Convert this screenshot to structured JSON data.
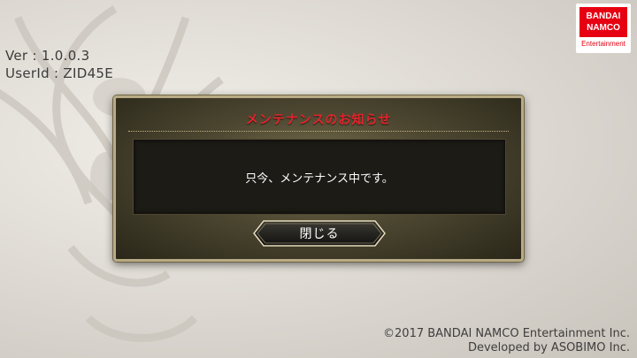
{
  "version_text": "Ver : 1.0.0.3",
  "user_id_text": "UserId : ZID45E",
  "publisher_logo": {
    "line1": "BANDAI",
    "line2": "NAMCO",
    "sub": "Entertainment",
    "brand_color": "#e60012"
  },
  "dialog": {
    "title": "メンテナンスのお知らせ",
    "message": "只今、メンテナンス中です。",
    "close_label": "閉じる",
    "title_color": "#e4242b"
  },
  "background_icon": "winged-emblem-icon",
  "copyright": {
    "line1": "©2017 BANDAI NAMCO Entertainment Inc.",
    "line2": "Developed by ASOBIMO Inc."
  }
}
